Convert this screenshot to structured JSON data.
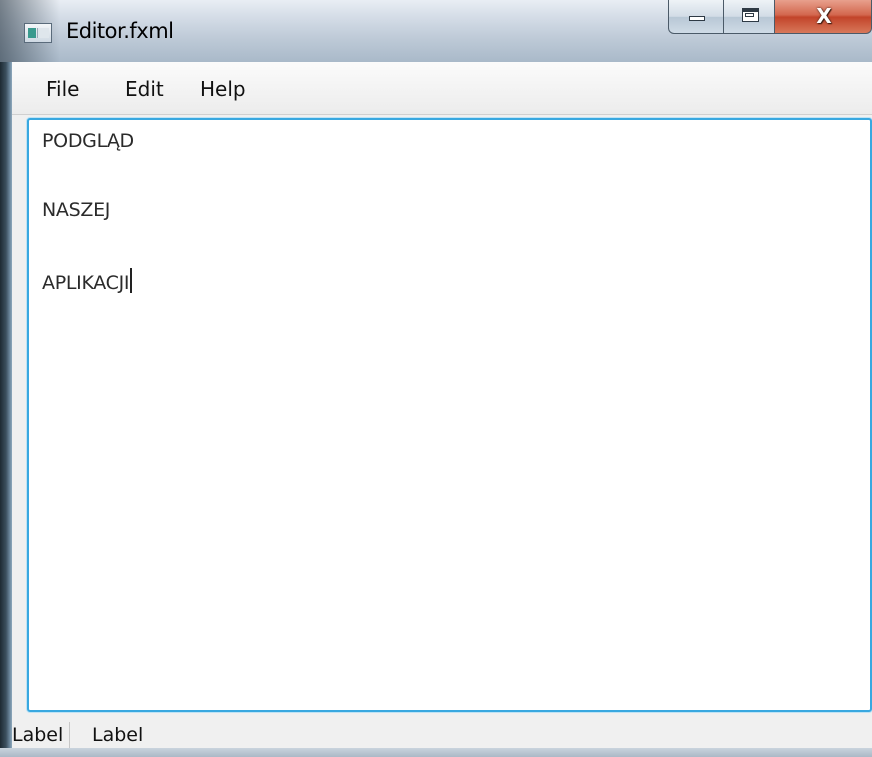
{
  "window": {
    "title": "Editor.fxml",
    "icon": "application-window-icon",
    "controls": {
      "minimize": "minimize-icon",
      "maximize": "maximize-icon",
      "close_label": "X"
    }
  },
  "menubar": {
    "items": [
      {
        "label": "File"
      },
      {
        "label": "Edit"
      },
      {
        "label": "Help"
      }
    ]
  },
  "editor": {
    "lines": [
      "PODGLĄD",
      "NASZEJ",
      "APLIKACJI"
    ],
    "focus_color": "#39a8e0"
  },
  "statusbar": {
    "labels": [
      "Label",
      "Label"
    ]
  },
  "colors": {
    "close_button": "#c2442a",
    "focus_border": "#39a8e0"
  }
}
